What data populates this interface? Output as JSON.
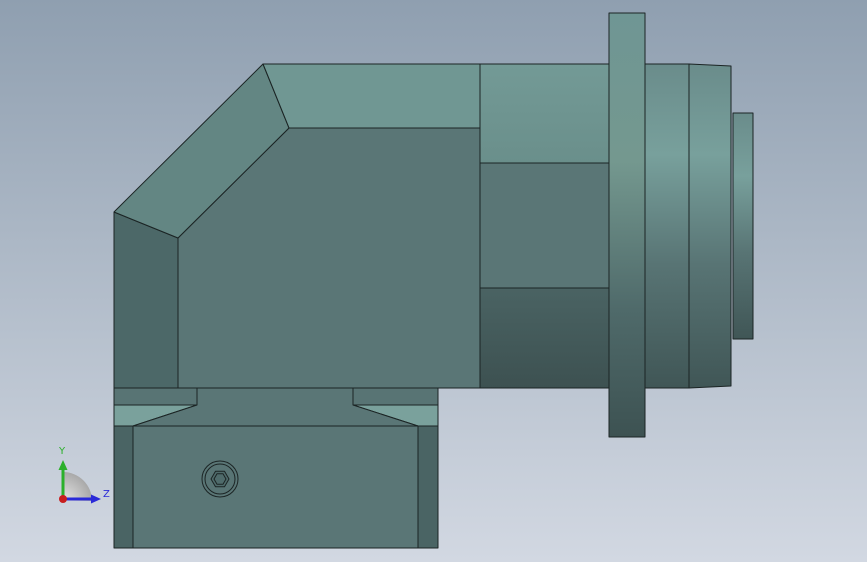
{
  "viewport": {
    "background_top": "#8f9fb0",
    "background_bottom": "#d2d8e2"
  },
  "part": {
    "outline_color": "#1b2424",
    "face_light": "#739a96",
    "face_mid": "#5a7676",
    "face_dark": "#486262",
    "face_shadow": "#3c5050"
  },
  "triad": {
    "y_label": "Y",
    "z_label": "Z",
    "y_color": "#2bb02b",
    "z_color": "#2a2ad8",
    "x_color": "#c81e1e"
  }
}
